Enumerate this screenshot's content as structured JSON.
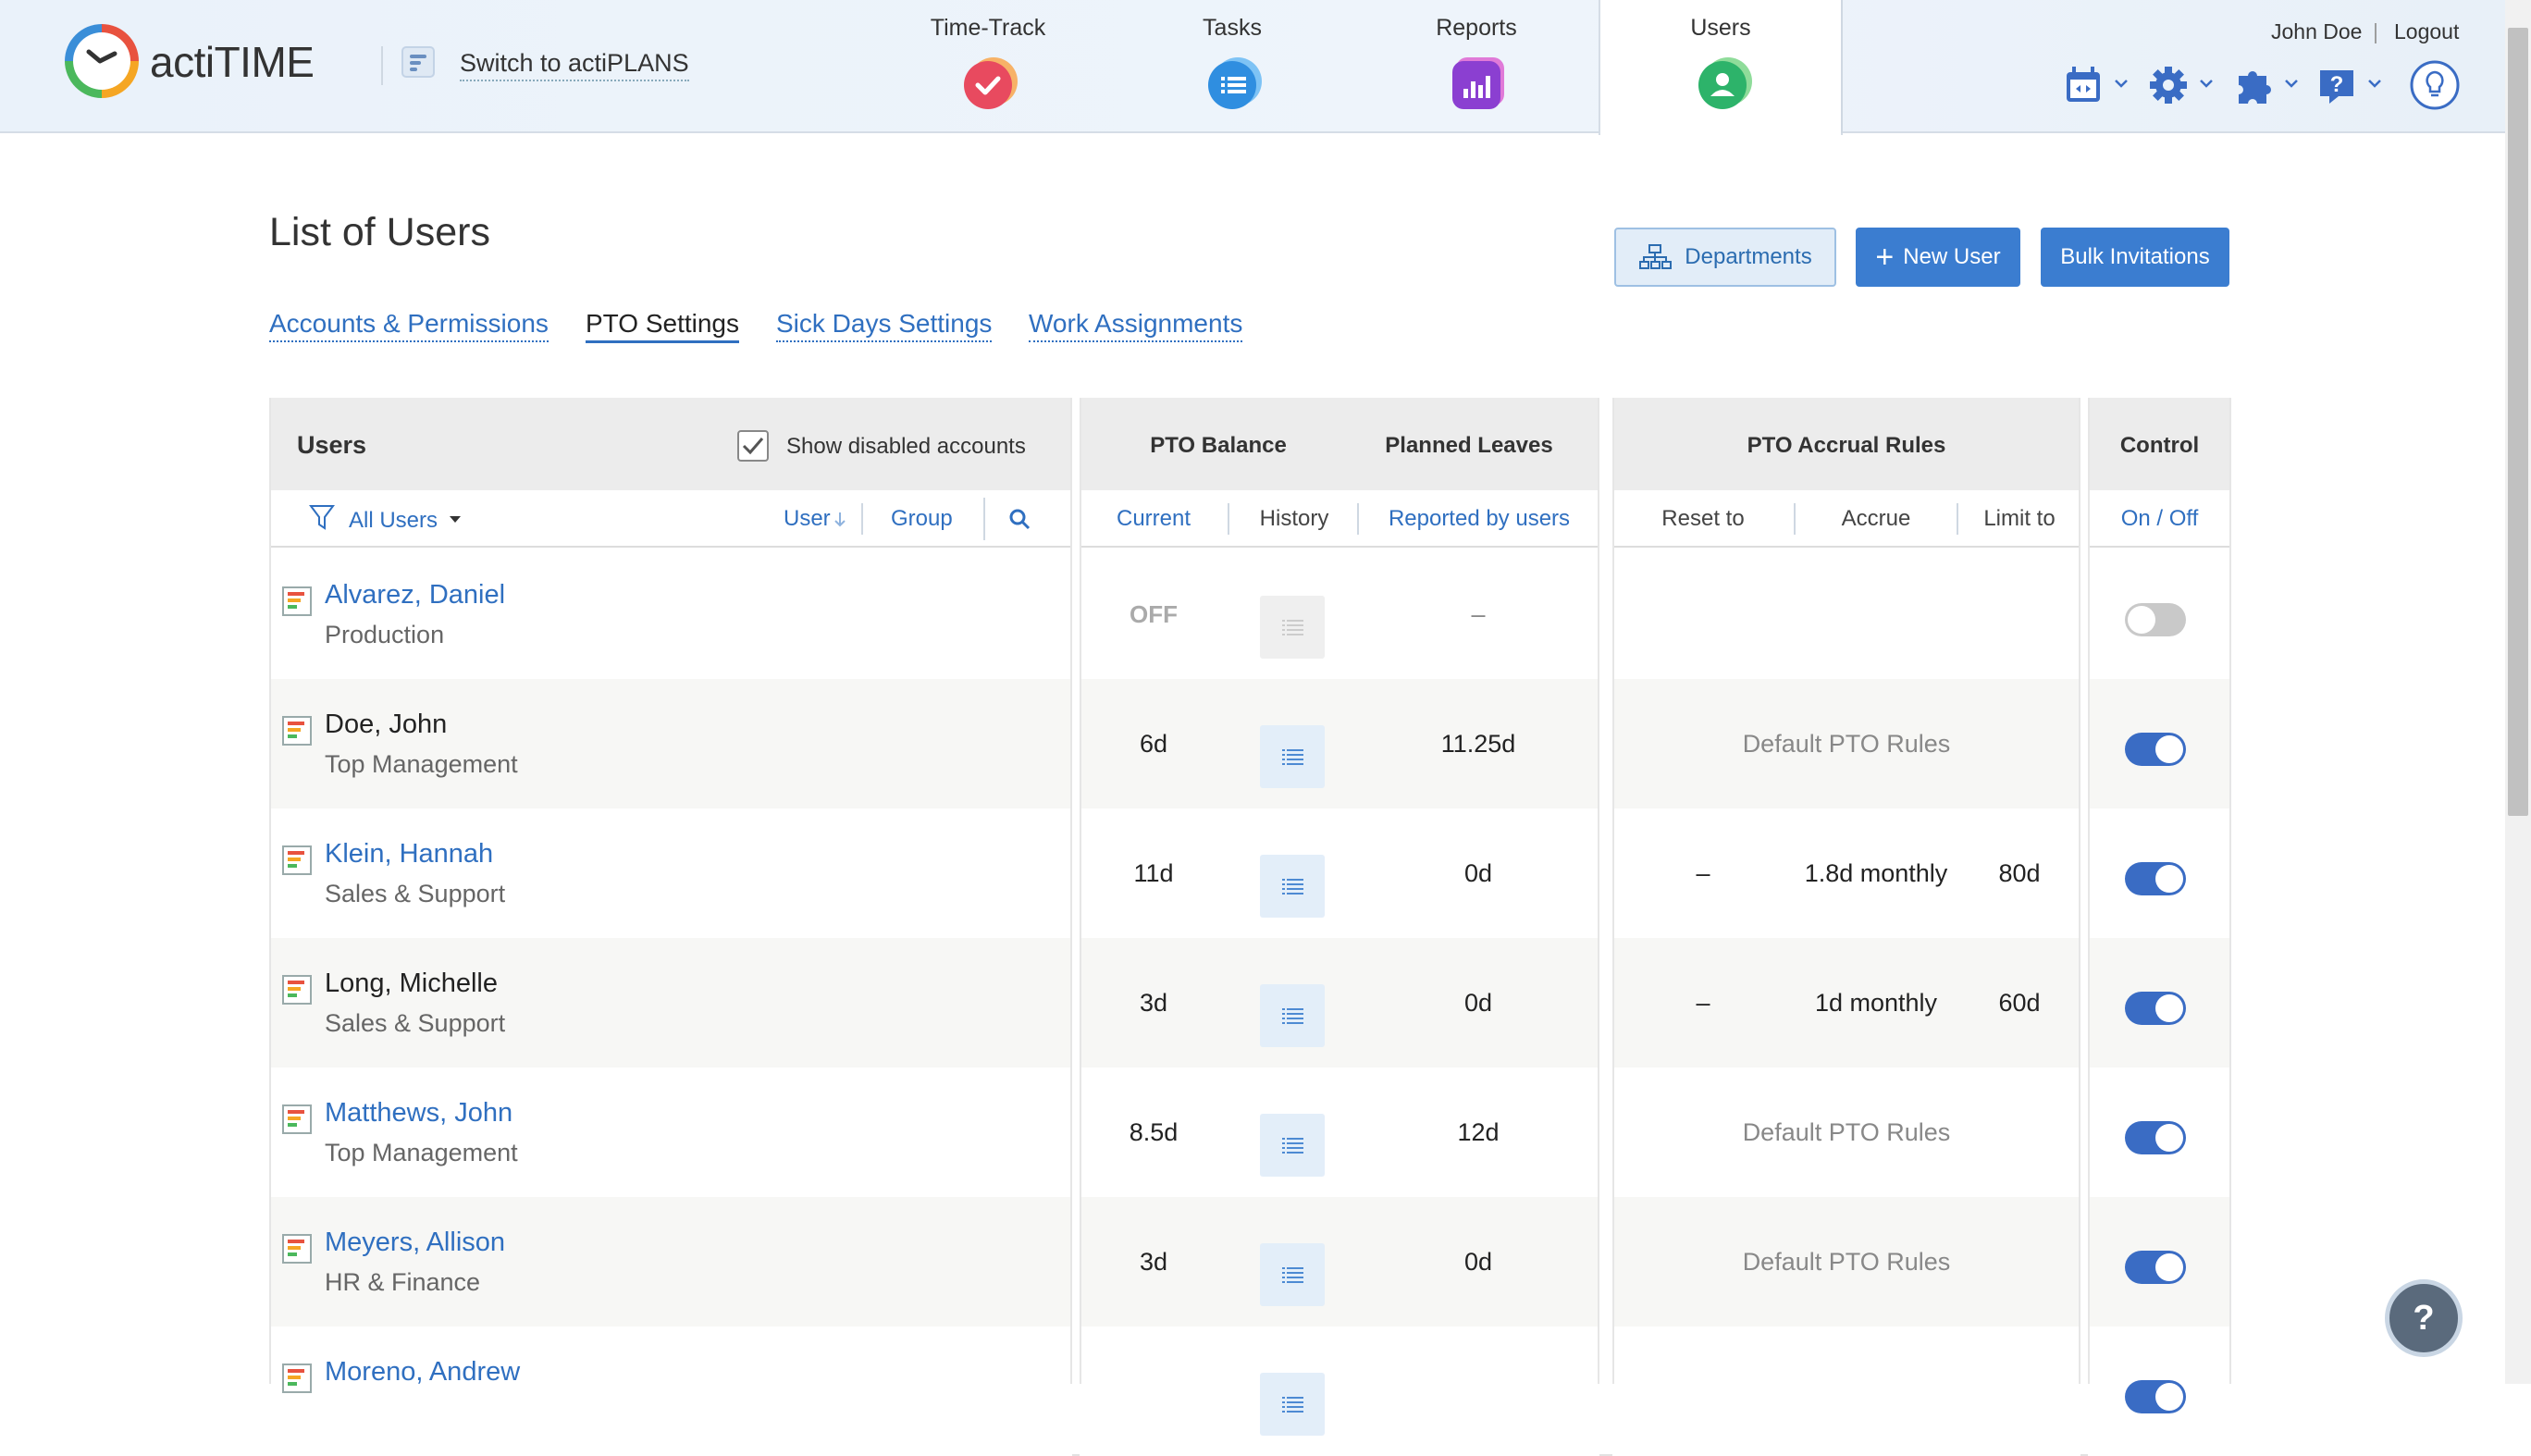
{
  "app": {
    "name": "actiTIME",
    "switch_label": "Switch to actiPLANS"
  },
  "nav": {
    "tabs": [
      {
        "label": "Time-Track",
        "color": "#e84a5f"
      },
      {
        "label": "Tasks",
        "color": "#2f8ee0"
      },
      {
        "label": "Reports",
        "color": "#8b3fd1"
      },
      {
        "label": "Users",
        "color": "#2db36a"
      }
    ]
  },
  "user_menu": {
    "name": "John Doe",
    "logout": "Logout"
  },
  "page": {
    "title": "List of Users"
  },
  "buttons": {
    "departments": "Departments",
    "new_user": "New User",
    "bulk_invitations": "Bulk Invitations"
  },
  "subtabs": [
    "Accounts & Permissions",
    "PTO Settings",
    "Sick Days Settings",
    "Work Assignments"
  ],
  "table": {
    "headers": {
      "users": "Users",
      "show_disabled": "Show disabled accounts",
      "pto_balance": "PTO Balance",
      "planned_leaves": "Planned Leaves",
      "pto_accrual_rules": "PTO Accrual Rules",
      "control": "Control"
    },
    "subheaders": {
      "filter": "All Users",
      "user": "User",
      "group": "Group",
      "current": "Current",
      "history": "History",
      "reported_by_users": "Reported by users",
      "reset_to": "Reset to",
      "accrue": "Accrue",
      "limit_to": "Limit to",
      "on_off": "On / Off"
    },
    "rows": [
      {
        "name": "Alvarez, Daniel",
        "dept": "Production",
        "current": "OFF",
        "planned": "–",
        "reset": "",
        "accrue": "",
        "limit": "",
        "rules": "",
        "enabled": false,
        "link": true
      },
      {
        "name": "Doe, John",
        "dept": "Top Management",
        "current": "6d",
        "planned": "11.25d",
        "reset": "",
        "accrue": "",
        "limit": "",
        "rules": "Default PTO Rules",
        "enabled": true,
        "link": false
      },
      {
        "name": "Klein, Hannah",
        "dept": "Sales & Support",
        "current": "11d",
        "planned": "0d",
        "reset": "–",
        "accrue": "1.8d monthly",
        "limit": "80d",
        "rules": "",
        "enabled": true,
        "link": true
      },
      {
        "name": "Long, Michelle",
        "dept": "Sales & Support",
        "current": "3d",
        "planned": "0d",
        "reset": "–",
        "accrue": "1d monthly",
        "limit": "60d",
        "rules": "",
        "enabled": true,
        "link": false
      },
      {
        "name": "Matthews, John",
        "dept": "Top Management",
        "current": "8.5d",
        "planned": "12d",
        "reset": "",
        "accrue": "",
        "limit": "",
        "rules": "Default PTO Rules",
        "enabled": true,
        "link": true
      },
      {
        "name": "Meyers, Allison",
        "dept": "HR & Finance",
        "current": "3d",
        "planned": "0d",
        "reset": "",
        "accrue": "",
        "limit": "",
        "rules": "Default PTO Rules",
        "enabled": true,
        "link": true
      },
      {
        "name": "Moreno, Andrew",
        "dept": "",
        "current": "",
        "planned": "",
        "reset": "",
        "accrue": "",
        "limit": "",
        "rules": "",
        "enabled": true,
        "link": true
      }
    ]
  },
  "help_fab": "?"
}
